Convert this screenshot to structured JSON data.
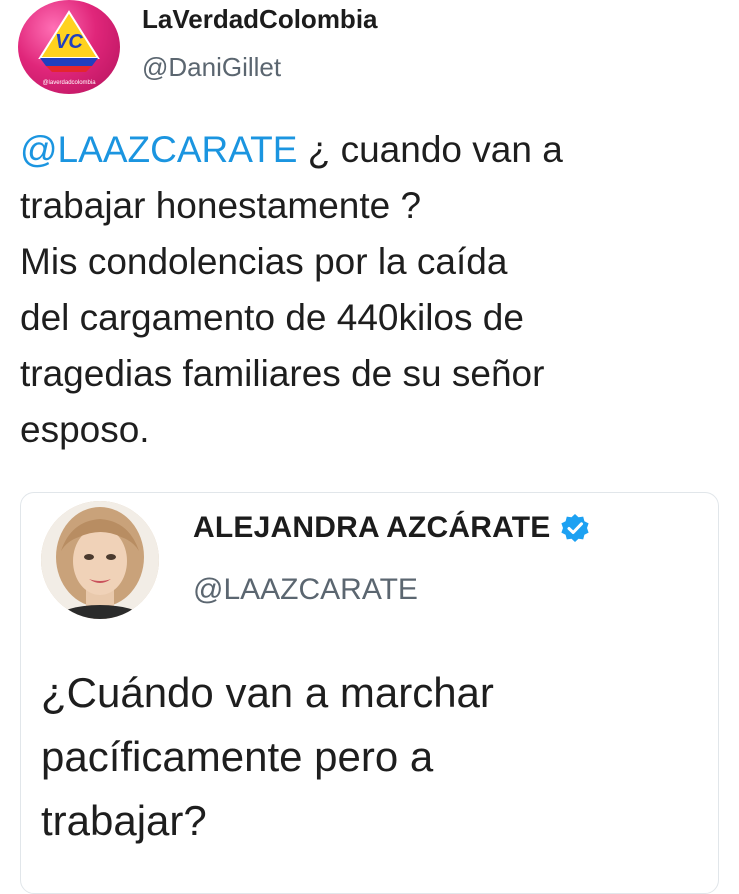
{
  "tweet": {
    "author": {
      "name": "LaVerdadColombia",
      "handle": "@DaniGillet",
      "avatar_icon": "laverdadcolombia-logo-avatar",
      "avatar_logo_text": "VC",
      "avatar_caption": "@laverdadcolombia"
    },
    "mention": "@LAAZCARATE",
    "body_lines": [
      " ¿ cuando van a",
      "trabajar honestamente ?",
      "Mis condolencias por la caída",
      "del cargamento de 440kilos de",
      "tragedias familiares de su señor",
      "esposo."
    ]
  },
  "quoted_tweet": {
    "author": {
      "name": "ALEJANDRA AZCÁRATE",
      "handle": "@LAAZCARATE",
      "verified": true,
      "verified_icon": "verified-check-icon",
      "avatar_icon": "profile-photo-avatar"
    },
    "body_lines": [
      "¿Cuándo van a marchar",
      "pacíficamente pero a",
      "trabajar?"
    ]
  },
  "colors": {
    "mention": "#1b95e0",
    "verified": "#1da1f2",
    "text": "#1e1e1e",
    "handle": "#5b6670"
  }
}
